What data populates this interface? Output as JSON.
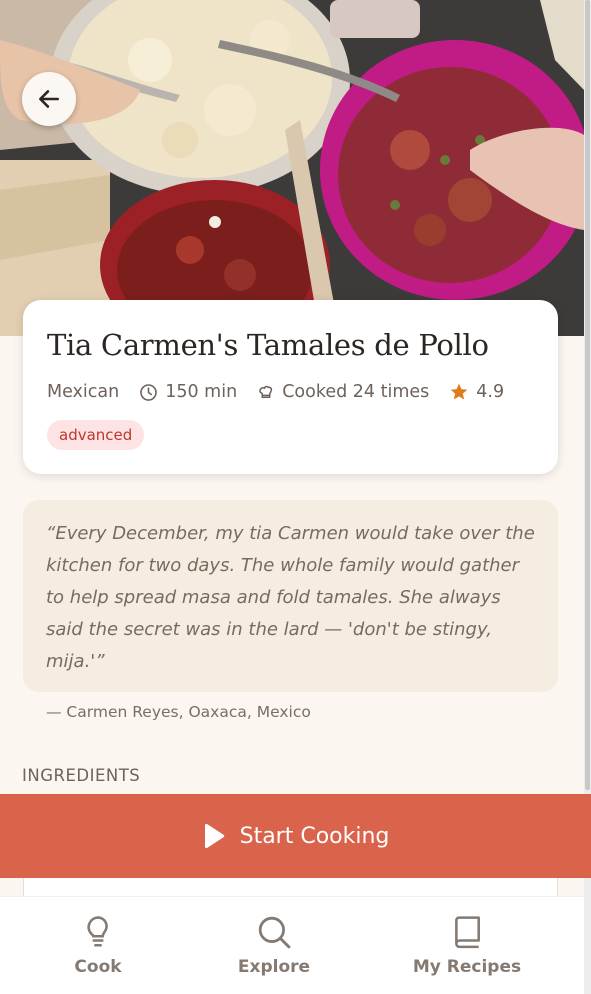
{
  "recipe": {
    "title": "Tia Carmen's Tamales de Pollo",
    "cuisine": "Mexican",
    "time": "150 min",
    "cooked": "Cooked 24 times",
    "rating": "4.9",
    "difficulty": "advanced"
  },
  "story": {
    "quote": "“Every December, my tia Carmen would take over the kitchen for two days. The whole family would gather to help spread masa and fold tamales. She always said the secret was in the lard — 'don't be stingy, mija.'”",
    "attribution": "— Carmen Reyes, Oaxaca, Mexico"
  },
  "sections": {
    "ingredients_label": "INGREDIENTS"
  },
  "actions": {
    "start_cooking": "Start Cooking"
  },
  "nav": {
    "items": [
      {
        "label": "Cook",
        "icon": "lightbulb-icon"
      },
      {
        "label": "Explore",
        "icon": "search-icon"
      },
      {
        "label": "My Recipes",
        "icon": "book-icon"
      }
    ]
  },
  "colors": {
    "accent": "#d9634b",
    "star": "#e07b1a",
    "badge_bg": "#fde3e3",
    "badge_text": "#c0362c",
    "quote_bg": "#f6ede2",
    "page_bg": "#fcf6f1"
  }
}
